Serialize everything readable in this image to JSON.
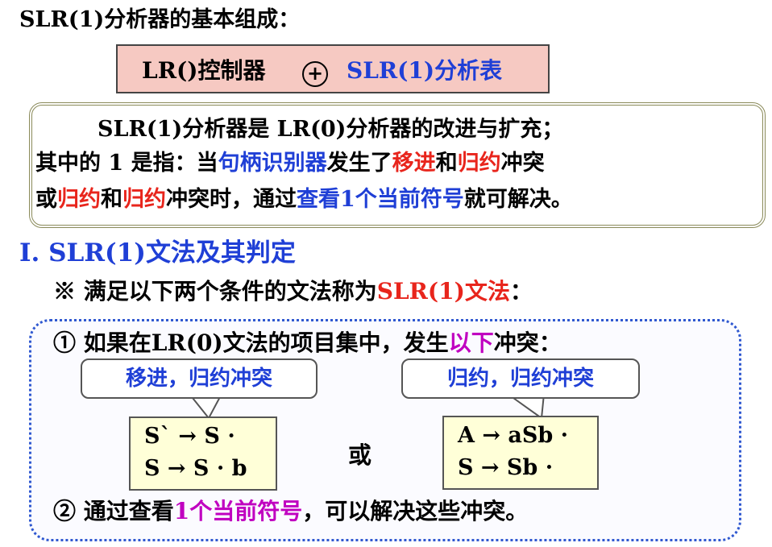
{
  "title": "SLR(1)分析器的基本组成：",
  "formula": {
    "left": "LR()控制器",
    "operator": "+",
    "right": "SLR(1)分析表"
  },
  "intro": {
    "line1": "SLR(1)分析器是 LR(0)分析器的改进与扩充；",
    "line2": {
      "p1": "其中的 1 是指：当",
      "p2": "句柄识别器",
      "p3": "发生了",
      "p4": "移进",
      "p5": "和",
      "p6": "归约",
      "p7": "冲突"
    },
    "line3": {
      "p1": "或",
      "p2": "归约",
      "p3": "和",
      "p4": "归约",
      "p5": "冲突时，通过",
      "p6": "查看1个当前符号",
      "p7": "就可解决。"
    }
  },
  "section_heading": "I.  SLR(1)文法及其判定",
  "note": {
    "prefix": "※ 满足以下两个条件的文法称为",
    "highlight": "SLR(1)文法",
    "suffix": "："
  },
  "condition1": {
    "prefix": "① 如果在LR(0)文法的项目集中，发生",
    "highlight": "以下",
    "suffix": "冲突："
  },
  "callouts": {
    "left": "移进，归约冲突",
    "right": "归约，归约冲突"
  },
  "productions": {
    "left": [
      "S` → S ·",
      "S → S · b"
    ],
    "right": [
      "A → aSb ·",
      "S → Sb ·"
    ]
  },
  "or_label": "或",
  "condition2": {
    "prefix": "② 通过查看",
    "highlight": "1个当前符号",
    "suffix": "，可以解决这些冲突。"
  },
  "colors": {
    "blue": "#1f3fd6",
    "red": "#e8251c",
    "purple": "#c000c0",
    "formula_box": "#f6c9c2",
    "production_box": "#ffffd8"
  }
}
